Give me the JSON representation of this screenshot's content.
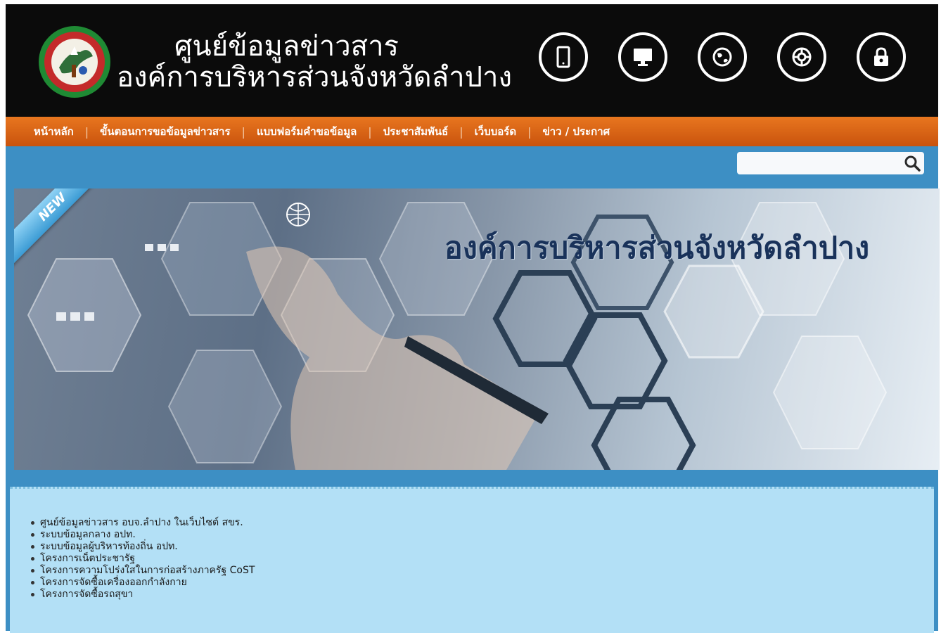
{
  "header": {
    "title_line1": "ศูนย์ข้อมูลข่าวสาร",
    "title_line2": "องค์การบริหารส่วนจังหวัดลำปาง",
    "logo": "provincial-seal-logo",
    "icons": [
      "tablet-icon",
      "monitor-icon",
      "globe-icon",
      "lifebuoy-icon",
      "lock-icon"
    ]
  },
  "nav": {
    "items": [
      {
        "label": "หน้าหลัก"
      },
      {
        "label": "ขั้นตอนการขอข้อมูลข่าวสาร"
      },
      {
        "label": "แบบฟอร์มคำขอข้อมูล"
      },
      {
        "label": "ประชาสัมพันธ์"
      },
      {
        "label": "เว็บบอร์ด"
      },
      {
        "label": "ข่าว / ประกาศ"
      }
    ]
  },
  "search": {
    "placeholder": "",
    "icon": "magnifier-icon"
  },
  "banner": {
    "title": "องค์การบริหารส่วนจังหวัดลำปาง",
    "tag": "NEW"
  },
  "links": [
    "ศูนย์ข้อมูลข่าวสาร อบจ.ลำปาง ในเว็บไซต์ สขร.",
    "ระบบข้อมูลกลาง อปท.",
    "ระบบข้อมูลผู้บริหารท้องถิ่น อปท.",
    "โครงการเน็ตประชารัฐ",
    "โครงการความโปร่งใสในการก่อสร้างภาครัฐ CoST",
    "โครงการจัดซื้อเครื่องออกกำลังกาย",
    "โครงการจัดซื้อรถสุขา"
  ],
  "colors": {
    "header_bg": "#0b0b0b",
    "nav_bg": "#d9651a",
    "main_bg": "#3d8fc4",
    "panel_bg": "#b3e0f6"
  }
}
